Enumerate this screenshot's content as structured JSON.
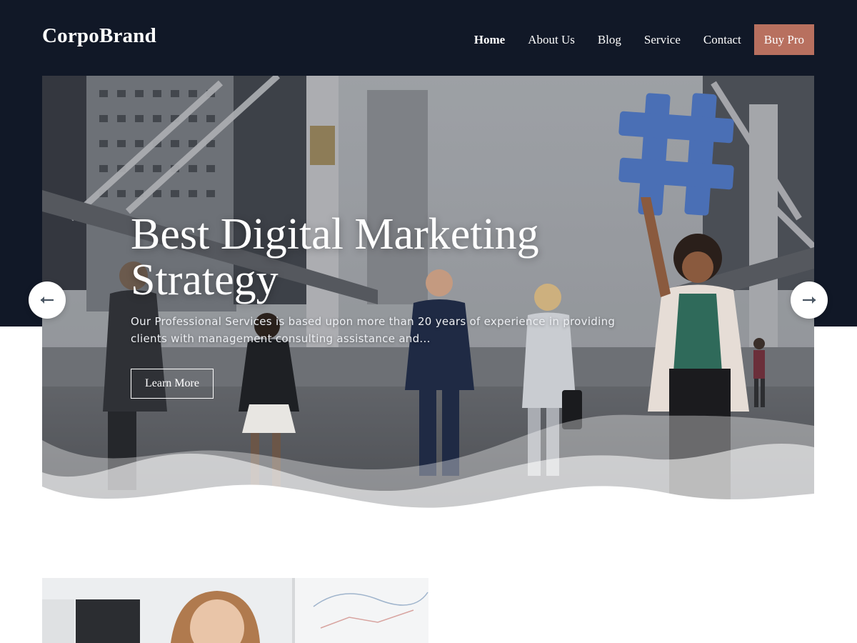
{
  "brand": {
    "name": "CorpoBrand"
  },
  "nav": {
    "items": [
      {
        "label": "Home"
      },
      {
        "label": "About Us"
      },
      {
        "label": "Blog"
      },
      {
        "label": "Service"
      },
      {
        "label": "Contact"
      }
    ],
    "cta_label": "Buy Pro"
  },
  "hero": {
    "title_line1": "Best Digital Marketing",
    "title_line2": "Strategy",
    "description": "Our Professional Services is based upon more than 20 years of experience in providing clients with management consulting assistance and...",
    "button_label": "Learn More"
  },
  "slider": {
    "prev_icon": "arrow-left-icon",
    "next_icon": "arrow-right-icon"
  },
  "colors": {
    "header_bg": "#111827",
    "accent": "#b8705f",
    "hashtag_blue": "#4a6fb5",
    "text_light": "#ffffff"
  }
}
